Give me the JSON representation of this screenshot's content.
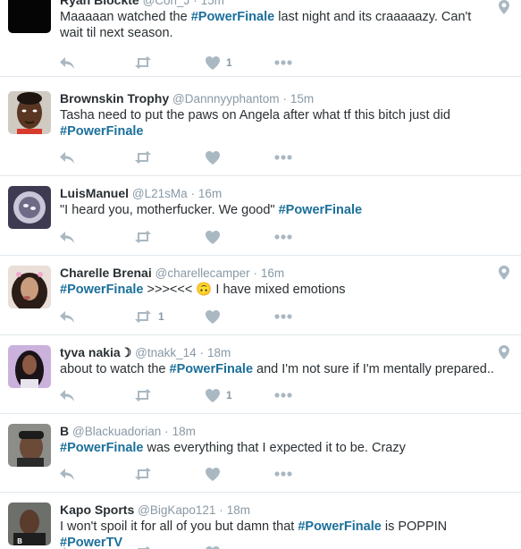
{
  "colors": {
    "hashtag": "#1b6f9a",
    "meta": "#8899a6",
    "text": "#292f33",
    "action": "#aab8c2",
    "divider": "#e1e8ed"
  },
  "tweets": [
    {
      "name": "Ryan Blockte",
      "handle": "@Cori_J",
      "time": "15m",
      "parts": [
        "Maaaaan watched the ",
        "#PowerFinale",
        " last night and its craaaaazy. Can't wait til next season."
      ],
      "retweets": "",
      "likes": "1",
      "location": true
    },
    {
      "name": "Brownskin Trophy",
      "handle": "@Dannnyyphantom",
      "time": "15m",
      "parts": [
        "Tasha need to put the paws on Angela after what tf this bitch just did ",
        "#PowerFinale",
        ""
      ],
      "retweets": "",
      "likes": "",
      "location": false
    },
    {
      "name": "LuisManuel",
      "handle": "@L21sMa",
      "time": "16m",
      "parts": [
        "\"I heard you, motherfucker. We good\" ",
        "#PowerFinale",
        ""
      ],
      "retweets": "",
      "likes": "",
      "location": false
    },
    {
      "name": "Charelle Brenai",
      "handle": "@charellecamper",
      "time": "16m",
      "parts": [
        "",
        "#PowerFinale",
        " >>><<< 🙃 I have mixed emotions"
      ],
      "retweets": "1",
      "likes": "",
      "location": true
    },
    {
      "name": "tyva nakia☽",
      "handle": "@tnakk_14",
      "time": "18m",
      "parts": [
        "about to watch the ",
        "#PowerFinale",
        " and I'm not sure if I'm mentally prepared.."
      ],
      "retweets": "",
      "likes": "1",
      "location": true
    },
    {
      "name": "B",
      "handle": "@Blackuadorian",
      "time": "18m",
      "parts": [
        "",
        "#PowerFinale",
        " was everything that I expected it to be. Crazy"
      ],
      "retweets": "",
      "likes": "",
      "location": false
    },
    {
      "name": "Kapo Sports",
      "handle": "@BigKapo121",
      "time": "18m",
      "parts": [
        "I won't spoil it for all of you but damn that ",
        "#PowerFinale",
        " is POPPIN ",
        "#PowerTV"
      ],
      "retweets": "",
      "likes": "",
      "location": false
    }
  ],
  "icons": {
    "reply": "reply-icon",
    "retweet": "retweet-icon",
    "like": "heart-icon",
    "more": "more-icon",
    "location": "location-pin-icon"
  }
}
